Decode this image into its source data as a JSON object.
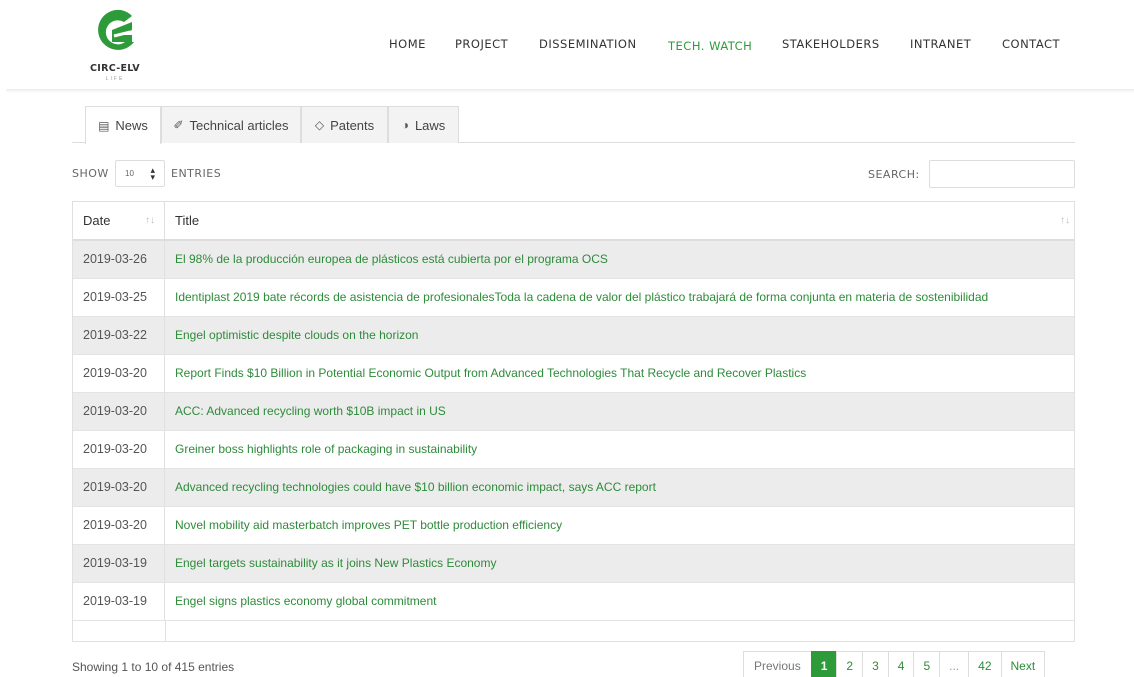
{
  "header": {
    "logo_text": "CIRC-ELV",
    "logo_sub": "LIFE",
    "nav": [
      {
        "label": "HOME"
      },
      {
        "label": "PROJECT"
      },
      {
        "label": "DISSEMINATION"
      },
      {
        "label": "TECH. WATCH"
      },
      {
        "label": "STAKEHOLDERS"
      },
      {
        "label": "INTRANET"
      },
      {
        "label": "CONTACT"
      }
    ],
    "active_nav": "TECH. WATCH"
  },
  "tabs": [
    {
      "label": "News",
      "icon": "newspaper-icon",
      "glyph": "▤"
    },
    {
      "label": "Technical articles",
      "icon": "flask-icon",
      "glyph": "✐"
    },
    {
      "label": "Patents",
      "icon": "diamond-icon",
      "glyph": "◇"
    },
    {
      "label": "Laws",
      "icon": "adjust-icon",
      "glyph": "◑"
    }
  ],
  "controls": {
    "show_label": "SHOW",
    "entries_value": "10",
    "entries_label": "ENTRIES",
    "search_label": "SEARCH:"
  },
  "table": {
    "columns": [
      "Date",
      "Title"
    ],
    "rows": [
      {
        "date": "2019-03-26",
        "title": "El 98% de la producción europea de plásticos está cubierta por el programa OCS"
      },
      {
        "date": "2019-03-25",
        "title": "Identiplast 2019 bate récords de asistencia de profesionalesToda la cadena de valor del plástico trabajará de forma conjunta en materia de sostenibilidad"
      },
      {
        "date": "2019-03-22",
        "title": "Engel optimistic despite clouds on the horizon"
      },
      {
        "date": "2019-03-20",
        "title": "Report Finds $10 Billion in Potential Economic Output from Advanced Technologies That Recycle and Recover Plastics"
      },
      {
        "date": "2019-03-20",
        "title": "ACC: Advanced recycling worth $10B impact in US"
      },
      {
        "date": "2019-03-20",
        "title": "Greiner boss highlights role of packaging in sustainability"
      },
      {
        "date": "2019-03-20",
        "title": "Advanced recycling technologies could have $10 billion economic impact, says ACC report"
      },
      {
        "date": "2019-03-20",
        "title": "Novel mobility aid masterbatch improves PET bottle production efficiency"
      },
      {
        "date": "2019-03-19",
        "title": "Engel targets sustainability as it joins New Plastics Economy"
      },
      {
        "date": "2019-03-19",
        "title": "Engel signs plastics economy global commitment"
      }
    ]
  },
  "footer": {
    "info": "Showing 1 to 10 of 415 entries",
    "pagination": {
      "previous": "Previous",
      "pages": [
        "1",
        "2",
        "3",
        "4",
        "5",
        "...",
        "42"
      ],
      "next": "Next",
      "current": "1"
    }
  },
  "colors": {
    "accent": "#2e9b3a",
    "link": "#2e8b3a",
    "row_alt": "#ececec"
  }
}
